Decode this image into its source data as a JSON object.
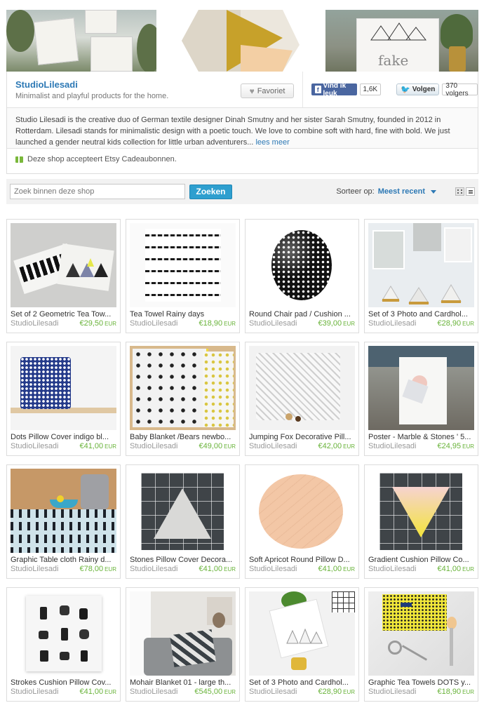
{
  "shop": {
    "name": "StudioLilesadi",
    "tagline": "Minimalist and playful products for the home.",
    "favorite_label": "Favoriet",
    "fb_like_label": "Vind ik leuk",
    "fb_count": "1,6K",
    "twitter_follow_label": "Volgen",
    "twitter_followers": "370 volgers",
    "description": "Studio Lilesadi is the creative duo of German textile designer Dinah Smutny and her sister Sarah Smutny, founded in 2012 in Rotterdam. Lilesadi stands for minimalistic design with a poetic touch. We love to combine soft with hard, fine with bold. We just launched a gender neutral kids collection for little urban adventurers...",
    "read_more": "lees meer",
    "giftcard_notice": "Deze shop accepteert Etsy Cadeaubonnen."
  },
  "toolbar": {
    "search_placeholder": "Zoek binnen deze shop",
    "search_button": "Zoeken",
    "sort_label": "Sorteer op:",
    "sort_value": "Meest recent"
  },
  "listings": [
    {
      "title": "Set of 2 Geometric Tea Tow...",
      "seller": "StudioLilesadi",
      "price": "€29,50",
      "currency": "EUR"
    },
    {
      "title": "Tea Towel Rainy days",
      "seller": "StudioLilesadi",
      "price": "€18,90",
      "currency": "EUR"
    },
    {
      "title": "Round Chair pad / Cushion ...",
      "seller": "StudioLilesadi",
      "price": "€39,00",
      "currency": "EUR"
    },
    {
      "title": "Set of 3 Photo and Cardhol...",
      "seller": "StudioLilesadi",
      "price": "€28,90",
      "currency": "EUR"
    },
    {
      "title": "Dots Pillow Cover indigo bl...",
      "seller": "StudioLilesadi",
      "price": "€41,00",
      "currency": "EUR"
    },
    {
      "title": "Baby Blanket /Bears newbo...",
      "seller": "StudioLilesadi",
      "price": "€49,00",
      "currency": "EUR"
    },
    {
      "title": "Jumping Fox Decorative Pill...",
      "seller": "StudioLilesadi",
      "price": "€42,00",
      "currency": "EUR"
    },
    {
      "title": "Poster - Marble & Stones ' 5...",
      "seller": "StudioLilesadi",
      "price": "€24,95",
      "currency": "EUR"
    },
    {
      "title": "Graphic Table cloth Rainy d...",
      "seller": "StudioLilesadi",
      "price": "€78,00",
      "currency": "EUR"
    },
    {
      "title": "Stones Pillow Cover Decora...",
      "seller": "StudioLilesadi",
      "price": "€41,00",
      "currency": "EUR"
    },
    {
      "title": "Soft Apricot Round Pillow D...",
      "seller": "StudioLilesadi",
      "price": "€41,00",
      "currency": "EUR"
    },
    {
      "title": "Gradient Cushion Pillow Co...",
      "seller": "StudioLilesadi",
      "price": "€41,00",
      "currency": "EUR"
    },
    {
      "title": "Strokes Cushion Pillow Cov...",
      "seller": "StudioLilesadi",
      "price": "€41,00",
      "currency": "EUR"
    },
    {
      "title": "Mohair Blanket 01 - large th...",
      "seller": "StudioLilesadi",
      "price": "€545,00",
      "currency": "EUR"
    },
    {
      "title": "Set of 3 Photo and Cardhol...",
      "seller": "StudioLilesadi",
      "price": "€28,90",
      "currency": "EUR"
    },
    {
      "title": "Graphic Tea Towels DOTS y...",
      "seller": "StudioLilesadi",
      "price": "€18,90",
      "currency": "EUR"
    }
  ],
  "colors": {
    "link": "#2d79b5",
    "price": "#69b33a",
    "search_button": "#2e9fcf",
    "facebook": "#4a66a0"
  }
}
